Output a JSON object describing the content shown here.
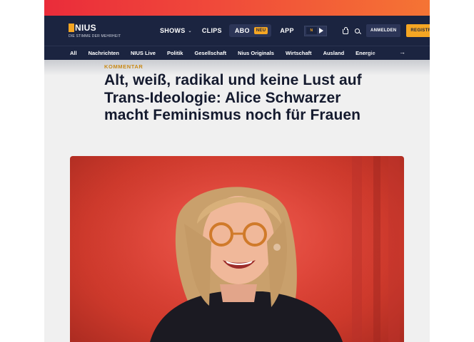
{
  "header": {
    "logo_text": "NIUS",
    "tagline": "DIE STIMME DER MEHRHEIT",
    "nav": [
      {
        "label": "SHOWS"
      },
      {
        "label": "CLIPS"
      },
      {
        "label": "ABO",
        "badge": "NEU"
      },
      {
        "label": "APP"
      }
    ],
    "login_label": "ANMELDEN",
    "register_label": "REGISTRI",
    "icons": [
      "shopping-bag-icon",
      "search-icon"
    ]
  },
  "subnav": {
    "items": [
      "All",
      "Nachrichten",
      "NIUS Live",
      "Politik",
      "Gesellschaft",
      "Nius Originals",
      "Wirtschaft",
      "Ausland",
      "Energie"
    ],
    "more_icon": "arrow-right-icon"
  },
  "article": {
    "kicker": "KOMMENTAR",
    "headline": "Alt, weiß, radikal und keine Lust auf Trans-Ideologie: Alice Schwarzer macht Feminismus noch für Frauen"
  },
  "colors": {
    "brand_navy": "#1b2440",
    "accent_orange": "#f5a623",
    "strip_red": "#ea2c3a",
    "hero_red": "#e4473a"
  }
}
